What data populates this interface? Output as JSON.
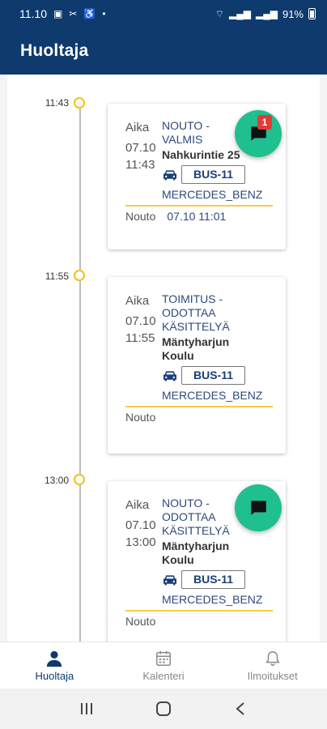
{
  "status_bar": {
    "time": "11.10",
    "battery": "91%"
  },
  "app_bar": {
    "title": "Huoltaja"
  },
  "entries": [
    {
      "time": "11:43",
      "aika_label": "Aika",
      "date": "07.10",
      "clock": "11:43",
      "status": "NOUTO - VALMIS",
      "address": "Nahkurintie 25",
      "bus": "BUS-11",
      "brand": "MERCEDES_BENZ",
      "footer_label": "Nouto",
      "footer_value": "07.10 11:01",
      "chat_badge": "1"
    },
    {
      "time": "11:55",
      "aika_label": "Aika",
      "date": "07.10",
      "clock": "11:55",
      "status": "TOIMITUS - ODOTTAA KÄSITTELYÄ",
      "address": "Mäntyharjun Koulu",
      "bus": "BUS-11",
      "brand": "MERCEDES_BENZ",
      "footer_label": "Nouto",
      "footer_value": ""
    },
    {
      "time": "13:00",
      "aika_label": "Aika",
      "date": "07.10",
      "clock": "13:00",
      "status": "NOUTO - ODOTTAA KÄSITTELYÄ",
      "address": "Mäntyharjun Koulu",
      "bus": "BUS-11",
      "brand": "MERCEDES_BENZ",
      "footer_label": "Nouto",
      "footer_value": ""
    }
  ],
  "bottom_nav": [
    {
      "label": "Huoltaja",
      "icon": "person-icon",
      "active": true
    },
    {
      "label": "Kalenteri",
      "icon": "calendar-icon",
      "active": false
    },
    {
      "label": "Ilmoitukset",
      "icon": "bell-icon",
      "active": false
    }
  ],
  "colors": {
    "primary": "#0e3a6e",
    "accent_green": "#1fbf8f",
    "timeline_yellow": "#f3c11b",
    "badge_red": "#e53935"
  }
}
